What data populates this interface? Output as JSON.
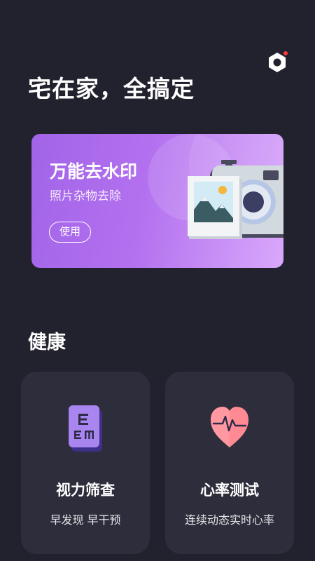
{
  "header": {
    "headline": "宅在家，全搞定"
  },
  "banner": {
    "title": "万能去水印",
    "subtitle": "照片杂物去除",
    "button_label": "使用"
  },
  "health": {
    "section_title": "健康",
    "cards": [
      {
        "title": "视力筛查",
        "subtitle": "早发现 早干预",
        "icon": "eye-chart-icon"
      },
      {
        "title": "心率测试",
        "subtitle": "连续动态实时心率",
        "icon": "heart-rate-icon"
      }
    ]
  },
  "colors": {
    "background": "#22222e",
    "card": "#2d2d3b",
    "banner_purple": "#b371ef",
    "notification_dot": "#ff3b3b",
    "heart_pink": "#ff8a94"
  }
}
